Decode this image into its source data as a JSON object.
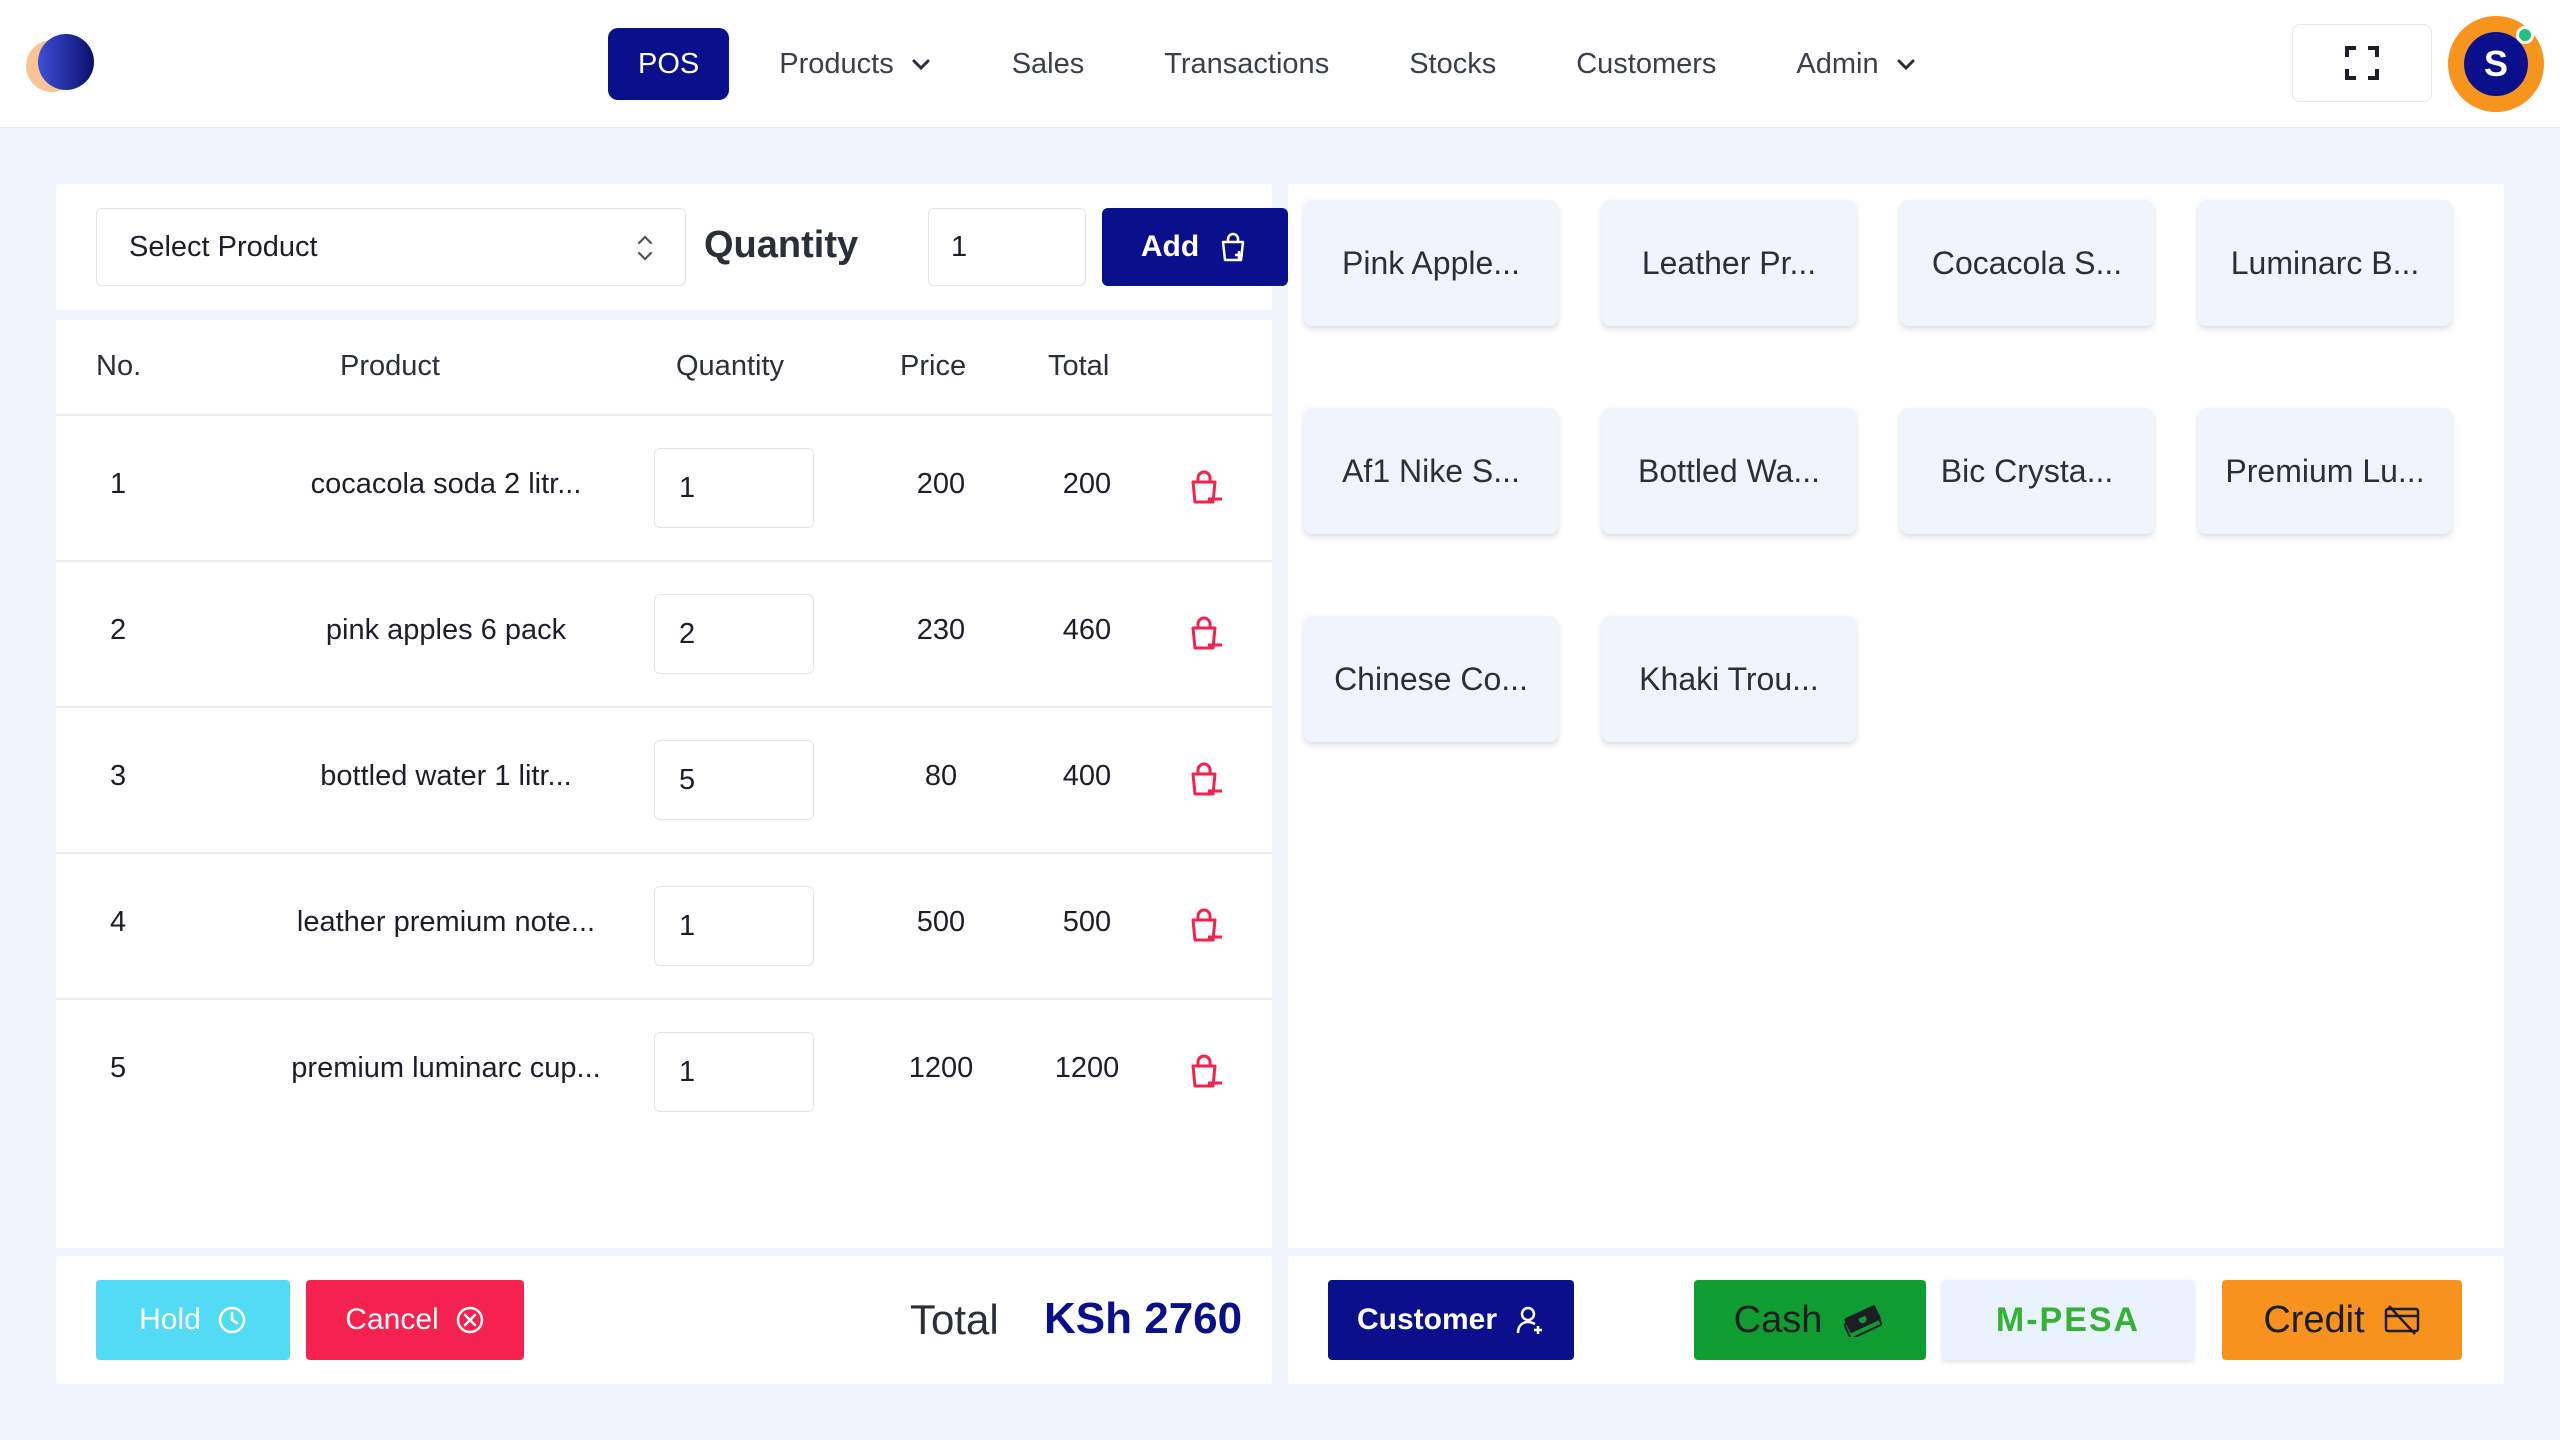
{
  "nav": {
    "items": [
      {
        "label": "POS",
        "active": true,
        "dropdown": false
      },
      {
        "label": "Products",
        "active": false,
        "dropdown": true
      },
      {
        "label": "Sales",
        "active": false,
        "dropdown": false
      },
      {
        "label": "Transactions",
        "active": false,
        "dropdown": false
      },
      {
        "label": "Stocks",
        "active": false,
        "dropdown": false
      },
      {
        "label": "Customers",
        "active": false,
        "dropdown": false
      },
      {
        "label": "Admin",
        "active": false,
        "dropdown": true
      }
    ],
    "fullscreen_icon": "expand-icon",
    "user": {
      "initial": "S",
      "status": "online"
    }
  },
  "entry": {
    "select_placeholder": "Select Product",
    "quantity_label": "Quantity",
    "quantity_value": "1",
    "add_label": "Add"
  },
  "table": {
    "headers": {
      "no": "No.",
      "product": "Product",
      "quantity": "Quantity",
      "price": "Price",
      "total": "Total"
    },
    "rows": [
      {
        "no": "1",
        "product": "cocacola soda 2 litr...",
        "qty": "1",
        "price": "200",
        "total": "200"
      },
      {
        "no": "2",
        "product": "pink apples 6 pack",
        "qty": "2",
        "price": "230",
        "total": "460"
      },
      {
        "no": "3",
        "product": "bottled water 1 litr...",
        "qty": "5",
        "price": "80",
        "total": "400"
      },
      {
        "no": "4",
        "product": "leather premium note...",
        "qty": "1",
        "price": "500",
        "total": "500"
      },
      {
        "no": "5",
        "product": "premium luminarc cup...",
        "qty": "1",
        "price": "1200",
        "total": "1200"
      }
    ]
  },
  "footer": {
    "hold_label": "Hold",
    "cancel_label": "Cancel",
    "total_label": "Total",
    "total_value": "KSh 2760"
  },
  "products": [
    "Pink Apple...",
    "Leather Pr...",
    "Cocacola S...",
    "Luminarc B...",
    "Af1 Nike S...",
    "Bottled Wa...",
    "Bic Crysta...",
    "Premium Lu...",
    "Chinese Co...",
    "Khaki Trou..."
  ],
  "payment": {
    "customer_label": "Customer",
    "cash_label": "Cash",
    "mpesa_label": "M-PESA",
    "credit_label": "Credit"
  },
  "colors": {
    "primary": "#0a0f8c",
    "hold": "#53dbf5",
    "cancel": "#f5224f",
    "cash": "#0f9d32",
    "credit": "#f7921e",
    "background": "#f0f5fd"
  }
}
